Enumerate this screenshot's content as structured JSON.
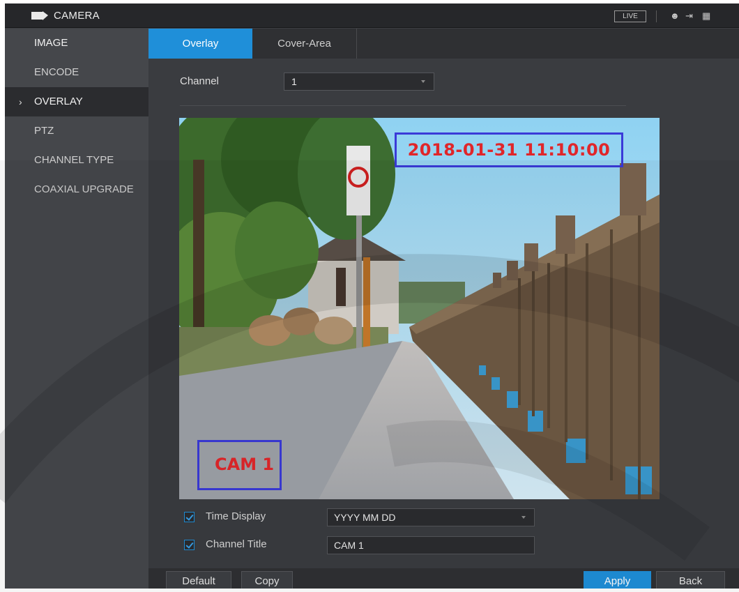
{
  "header": {
    "app_title": "CAMERA",
    "live_label": "LIVE",
    "icons": [
      "camera-icon",
      "user-icon",
      "logout-icon",
      "qr-code-icon"
    ]
  },
  "sidebar": {
    "items": [
      {
        "label": "IMAGE"
      },
      {
        "label": "ENCODE"
      },
      {
        "label": "OVERLAY",
        "active": true
      },
      {
        "label": "PTZ"
      },
      {
        "label": "CHANNEL TYPE"
      },
      {
        "label": "COAXIAL UPGRADE"
      }
    ]
  },
  "tabs": [
    {
      "label": "Overlay",
      "active": true
    },
    {
      "label": "Cover-Area"
    }
  ],
  "channel": {
    "label": "Channel",
    "value": "1"
  },
  "preview": {
    "time_overlay": "2018-01-31 11:10:00",
    "channel_title_overlay": "CAM 1"
  },
  "options": {
    "time_display": {
      "label": "Time Display",
      "checked": true,
      "value": "YYYY MM DD"
    },
    "channel_title": {
      "label": "Channel Title",
      "checked": true,
      "value": "CAM 1"
    }
  },
  "buttons": {
    "default": "Default",
    "copy": "Copy",
    "apply": "Apply",
    "back": "Back"
  },
  "colors": {
    "accent": "#1f8fd9",
    "overlay_text": "#e0262a",
    "overlay_box": "#3a3ad8"
  }
}
